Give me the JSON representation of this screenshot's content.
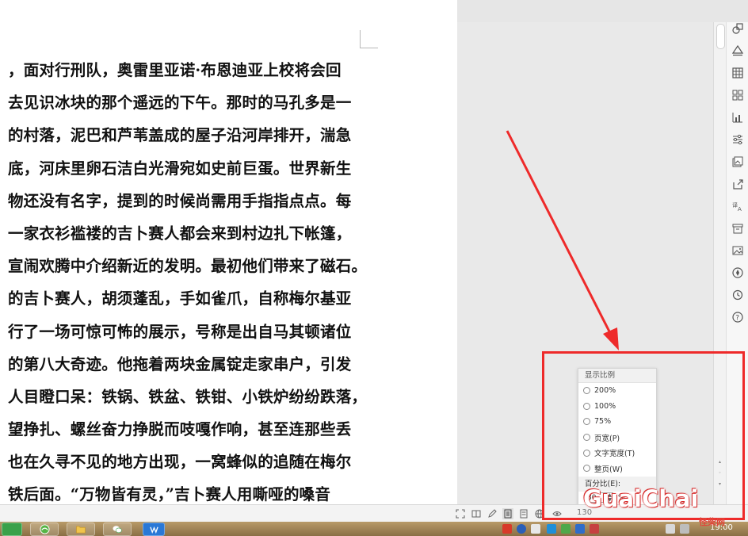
{
  "document": {
    "lines": [
      "，面对行刑队，奥雷里亚诺·布恩迪亚上校将会回",
      "去见识冰块的那个遥远的下午。那时的马孔多是一",
      "的村落，泥巴和芦苇盖成的屋子沿河岸排开，湍急",
      "底，河床里卵石洁白光滑宛如史前巨蛋。世界新生",
      "物还没有名字，提到的时候尚需用手指指点点。每",
      "一家衣衫褴褛的吉卜赛人都会来到村边扎下帐篷，",
      "宣闹欢腾中介绍新近的发明。最初他们带来了磁石。",
      "的吉卜赛人，胡须蓬乱，手如雀爪，自称梅尔基亚",
      "行了一场可惊可怖的展示，号称是出自马其顿诸位",
      "的第八大奇迹。他拖着两块金属锭走家串户，引发",
      "人目瞪口呆：铁锅、铁盆、铁钳、小铁炉纷纷跌落，",
      "望挣扎、螺丝奋力挣脱而吱嘎作响，甚至连那些丢",
      "也在久寻不见的地方出现，一窝蜂似的追随在梅尔",
      "铁后面。“万物皆有灵，”吉卜赛人用嘶哑的嗓音"
    ]
  },
  "zoom_popup": {
    "title": "显示比例",
    "options": [
      {
        "label": "200%",
        "selected": false
      },
      {
        "label": "100%",
        "selected": false
      },
      {
        "label": "75%",
        "selected": false
      },
      {
        "label": "页宽(P)",
        "selected": false
      },
      {
        "label": "文字宽度(T)",
        "selected": false
      },
      {
        "label": "整页(W)",
        "selected": false
      }
    ],
    "percent_label": "百分比(E):",
    "percent_value": "80",
    "percent_unit": "%"
  },
  "status_bar": {
    "zoom_text": "130"
  },
  "taskbar": {
    "clock": "19:00"
  },
  "watermark": {
    "main": "GuaiChai",
    "sub": "怪柴网"
  },
  "colors": {
    "highlight_red": "#ee2a2a",
    "page_bg": "#ffffff",
    "workspace_bg": "#e9e9e9"
  },
  "right_toolbar": {
    "icons": [
      "shapes-icon",
      "fill-icon",
      "table-icon",
      "grid-icon",
      "chart-icon",
      "filter-icon",
      "image-gallery-icon",
      "share-icon",
      "translate-icon",
      "archive-icon",
      "picture-icon",
      "compass-icon",
      "history-icon",
      "help-icon"
    ]
  }
}
